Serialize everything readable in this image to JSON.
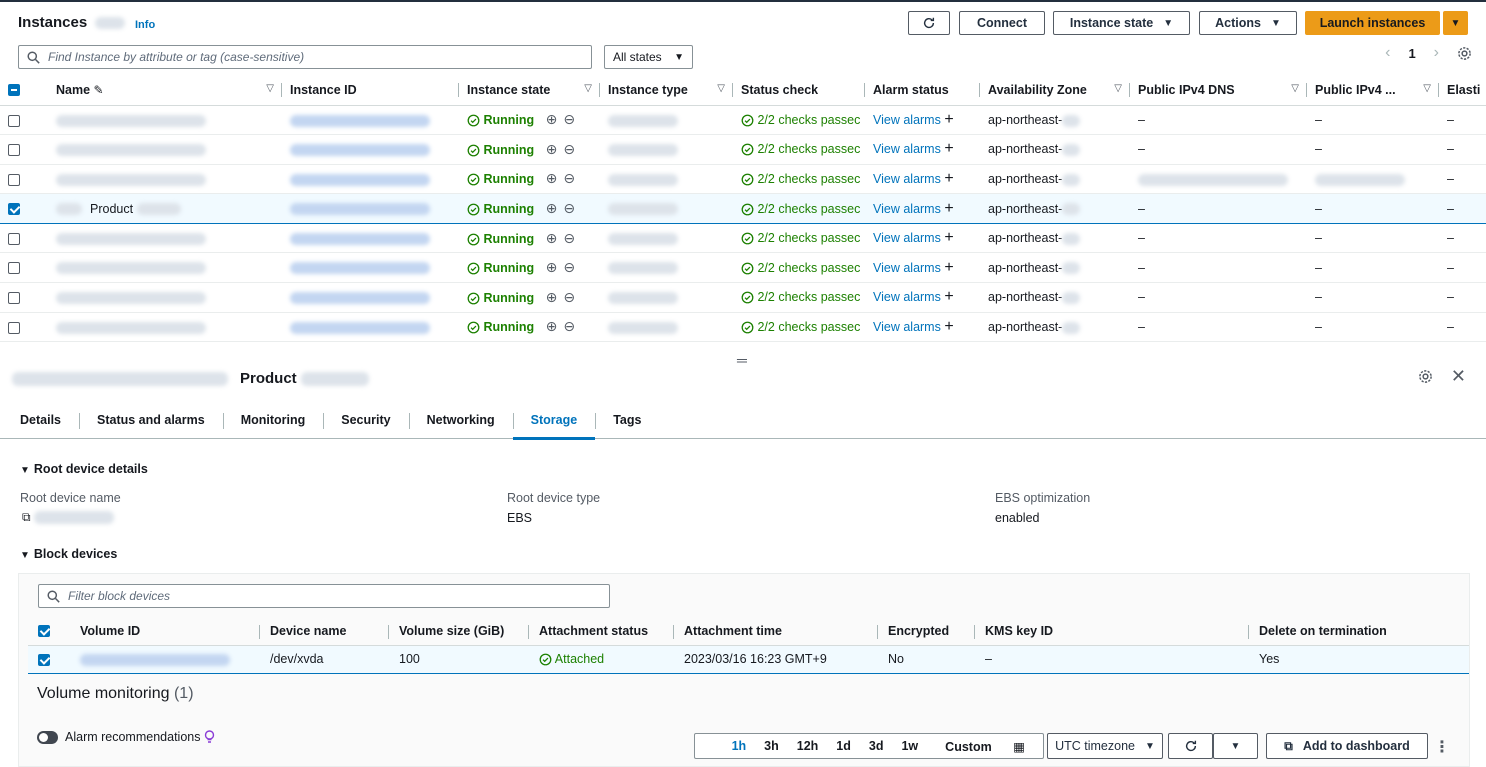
{
  "header": {
    "title": "Instances",
    "info": "Info",
    "refresh_icon": "refresh-icon",
    "connect": "Connect",
    "instance_state": "Instance state",
    "actions": "Actions",
    "launch": "Launch instances"
  },
  "filter": {
    "placeholder": "Find Instance by attribute or tag (case-sensitive)",
    "state_select": "All states",
    "page": "1"
  },
  "columns": [
    "Name",
    "Instance ID",
    "Instance state",
    "Instance type",
    "Status check",
    "Alarm status",
    "Availability Zone",
    "Public IPv4 DNS",
    "Public IPv4 ...",
    "Elasti"
  ],
  "rows": [
    {
      "name": "",
      "state": "Running",
      "status": "2/2 checks passec",
      "alarm": "View alarms",
      "az": "ap-northeast-",
      "dns": "–",
      "ip": "–",
      "el": "–",
      "selected": false
    },
    {
      "name": "",
      "state": "Running",
      "status": "2/2 checks passec",
      "alarm": "View alarms",
      "az": "ap-northeast-",
      "dns": "–",
      "ip": "–",
      "el": "–",
      "selected": false
    },
    {
      "name": "",
      "state": "Running",
      "status": "2/2 checks passec",
      "alarm": "View alarms",
      "az": "ap-northeast-",
      "dns": "",
      "ip": "",
      "el": "–",
      "selected": false
    },
    {
      "name": "Product",
      "state": "Running",
      "status": "2/2 checks passec",
      "alarm": "View alarms",
      "az": "ap-northeast-",
      "dns": "–",
      "ip": "–",
      "el": "–",
      "selected": true
    },
    {
      "name": "",
      "state": "Running",
      "status": "2/2 checks passec",
      "alarm": "View alarms",
      "az": "ap-northeast-",
      "dns": "–",
      "ip": "–",
      "el": "–",
      "selected": false
    },
    {
      "name": "",
      "state": "Running",
      "status": "2/2 checks passec",
      "alarm": "View alarms",
      "az": "ap-northeast-",
      "dns": "–",
      "ip": "–",
      "el": "–",
      "selected": false
    },
    {
      "name": "",
      "state": "Running",
      "status": "2/2 checks passec",
      "alarm": "View alarms",
      "az": "ap-northeast-",
      "dns": "–",
      "ip": "–",
      "el": "–",
      "selected": false
    },
    {
      "name": "",
      "state": "Running",
      "status": "2/2 checks passec",
      "alarm": "View alarms",
      "az": "ap-northeast-",
      "dns": "–",
      "ip": "–",
      "el": "–",
      "selected": false
    }
  ],
  "detail": {
    "title": "Product",
    "tabs": [
      "Details",
      "Status and alarms",
      "Monitoring",
      "Security",
      "Networking",
      "Storage",
      "Tags"
    ],
    "active_tab": "Storage",
    "root_section": "Root device details",
    "root_name_label": "Root device name",
    "root_type_label": "Root device type",
    "root_type_value": "EBS",
    "ebs_opt_label": "EBS optimization",
    "ebs_opt_value": "enabled",
    "block_section": "Block devices",
    "block_filter_placeholder": "Filter block devices",
    "block_columns": [
      "Volume ID",
      "Device name",
      "Volume size (GiB)",
      "Attachment status",
      "Attachment time",
      "Encrypted",
      "KMS key ID",
      "Delete on termination"
    ],
    "block_row": {
      "device": "/dev/xvda",
      "size": "100",
      "status": "Attached",
      "time": "2023/03/16 16:23 GMT+9",
      "encrypted": "No",
      "kms": "–",
      "delete": "Yes"
    },
    "volume_monitoring": "Volume monitoring",
    "volume_count": "(1)",
    "alarm_recommendations": "Alarm recommendations",
    "time_ranges": [
      "1h",
      "3h",
      "12h",
      "1d",
      "3d",
      "1w"
    ],
    "custom": "Custom",
    "timezone": "UTC timezone",
    "add_dashboard": "Add to dashboard"
  },
  "colors": {
    "accent": "#0073bb",
    "primary_button": "#ec9b18",
    "success": "#1d8102"
  }
}
